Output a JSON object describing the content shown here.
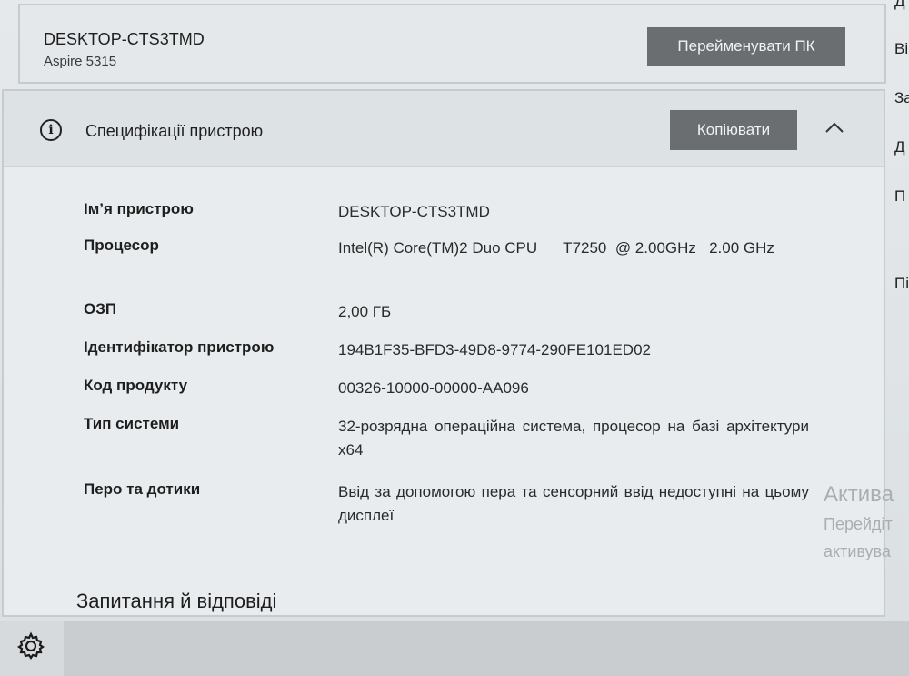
{
  "device": {
    "name": "DESKTOP-CTS3TMD",
    "model": "Aspire 5315",
    "rename_label": "Перейменувати ПК"
  },
  "specs": {
    "title": "Специфікації пристрою",
    "copy_label": "Копіювати",
    "rows": [
      {
        "label": "Ім’я пристрою",
        "value": "DESKTOP-CTS3TMD"
      },
      {
        "label": "Процесор",
        "value": "Intel(R) Core(TM)2 Duo CPU      T7250  @ 2.00GHz   2.00 GHz"
      },
      {
        "label": "ОЗП",
        "value": "2,00 ГБ"
      },
      {
        "label": "Ідентифікатор пристрою",
        "value": "194B1F35-BFD3-49D8-9774-290FE101ED02"
      },
      {
        "label": "Код продукту",
        "value": "00326-10000-00000-AA096"
      },
      {
        "label": "Тип системи",
        "value": "32-розрядна операційна система, процесор на базі архітектури x64"
      },
      {
        "label": "Перо та дотики",
        "value": "Ввід за допомогою пера та сенсорний ввід недоступні на цьому дисплеї"
      }
    ]
  },
  "faq": {
    "title": "Запитання й відповіді"
  },
  "watermark": {
    "line1": "Актива",
    "line2": "Перейдіт",
    "line3": "активува"
  },
  "right_edge": [
    "Д",
    "Ві",
    "За",
    "Д",
    "П",
    "Пі"
  ],
  "icons": {
    "info": "info-icon",
    "collapse": "chevron-up-icon",
    "settings": "gear-icon"
  }
}
